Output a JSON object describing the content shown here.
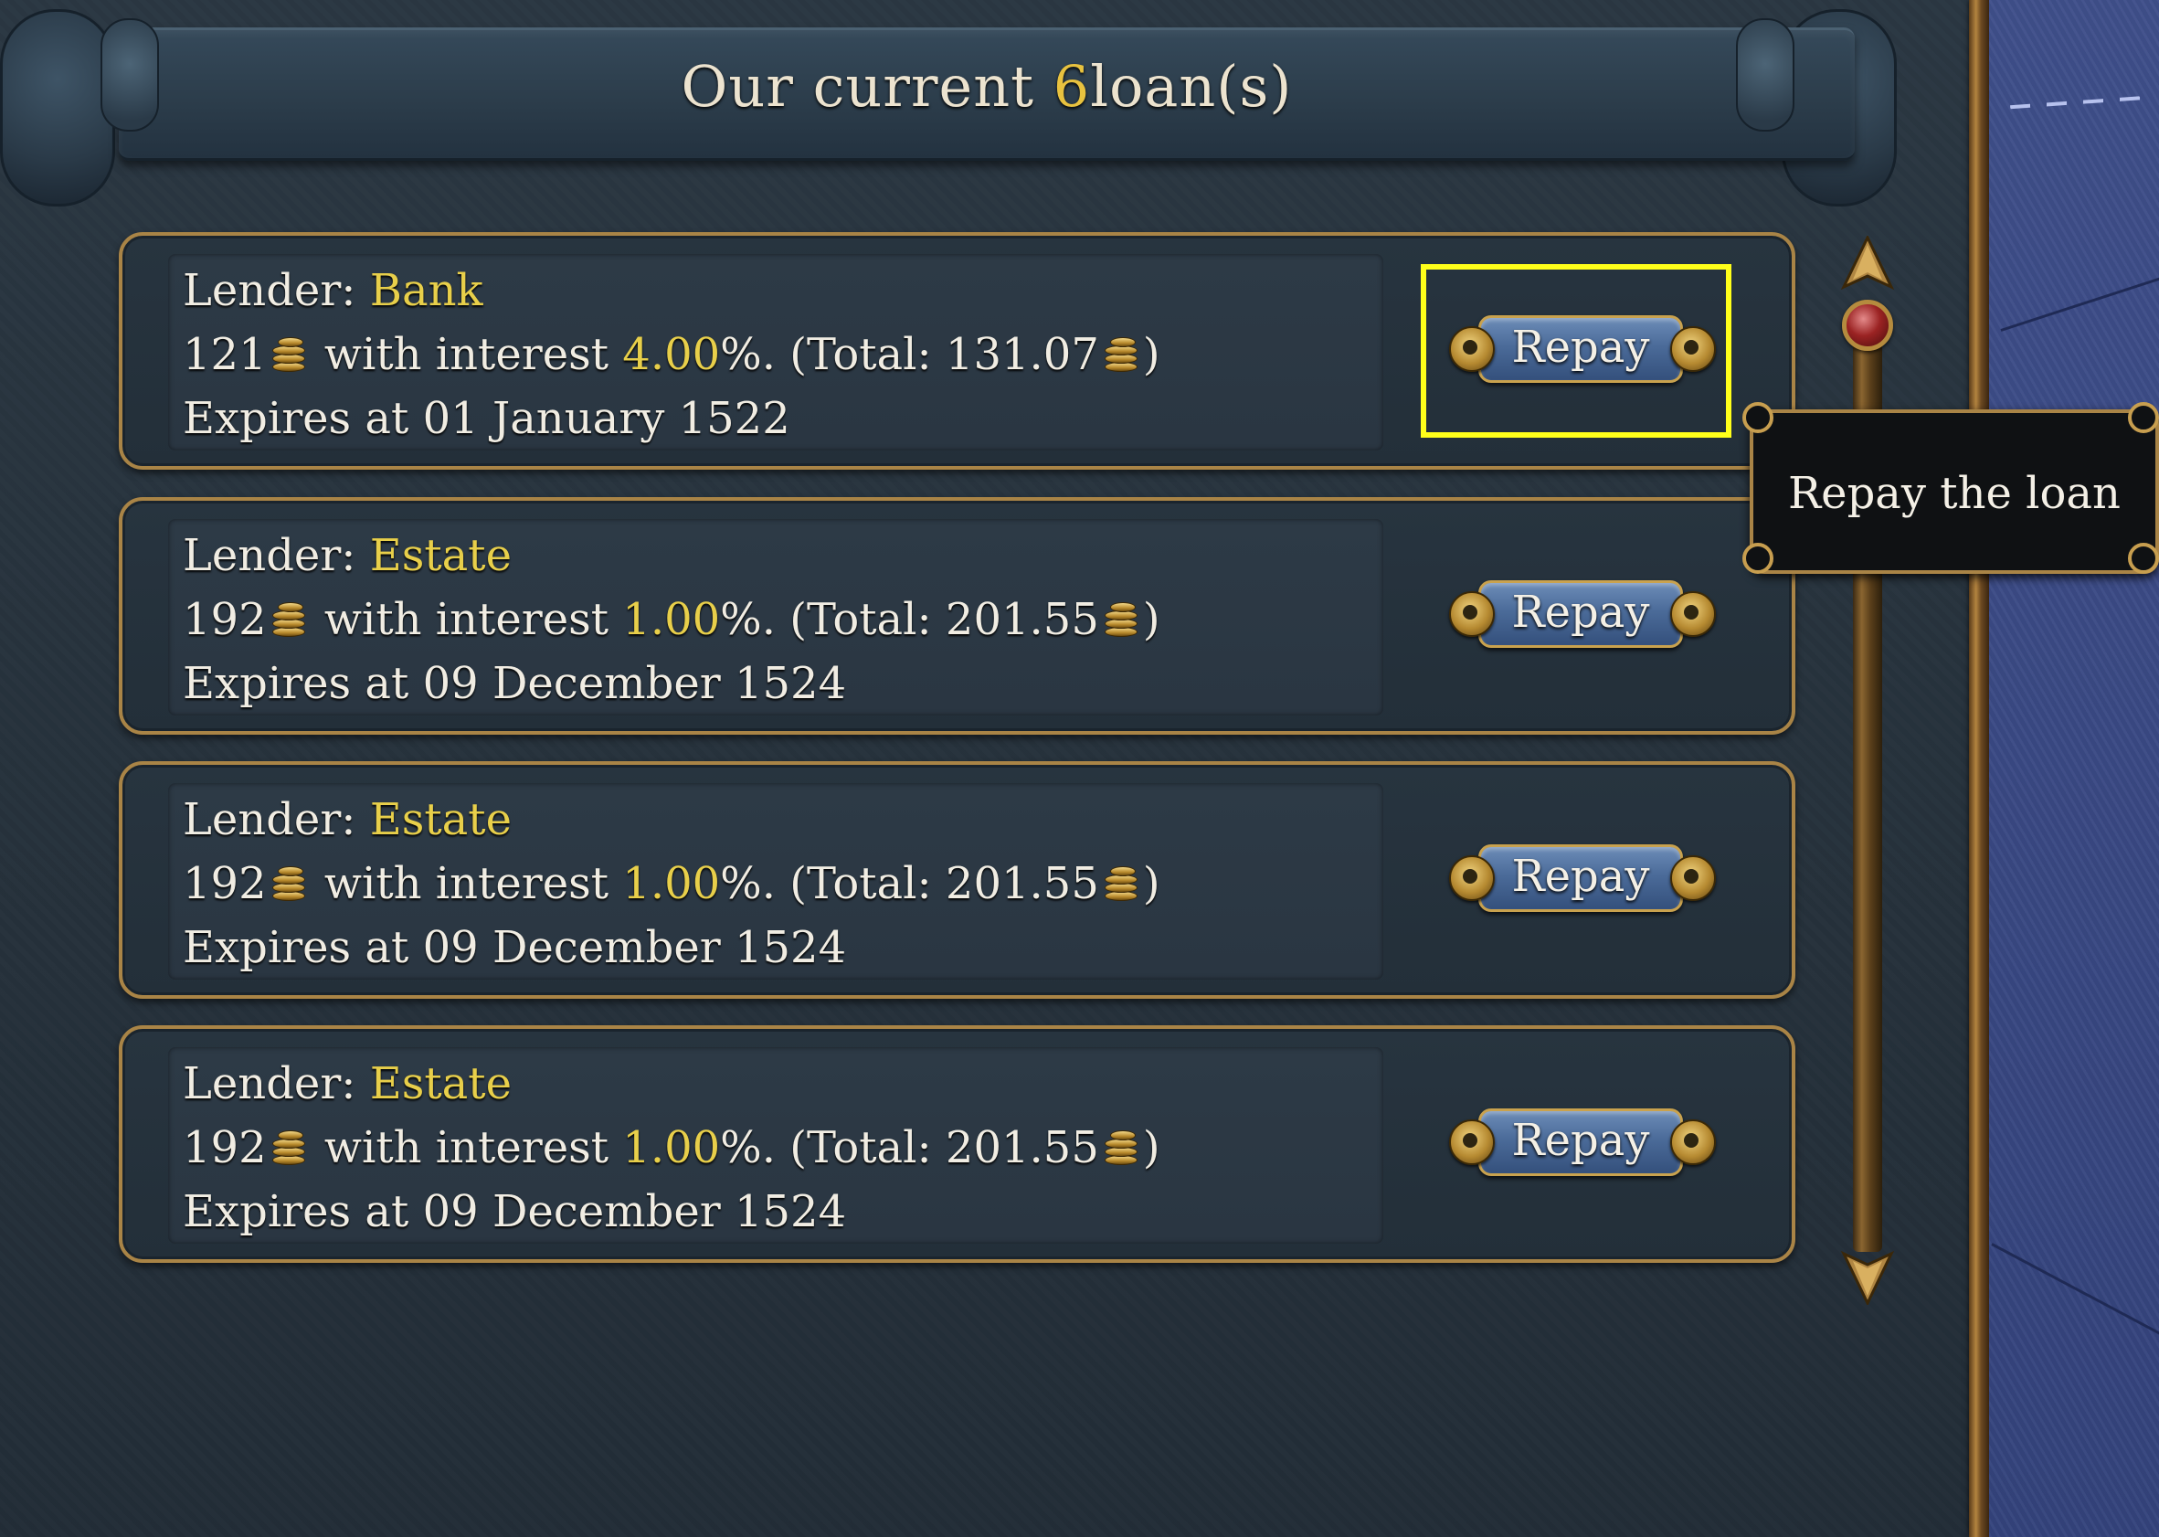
{
  "header": {
    "title_prefix": "Our current",
    "loan_count": "6",
    "title_suffix": "loan(s)"
  },
  "labels": {
    "lender": "Lender:",
    "with_interest": "with interest",
    "percent_suffix": "%. (Total:",
    "close_paren": ")",
    "expires_at": "Expires at"
  },
  "loans": [
    {
      "lender": "Bank",
      "amount": "121",
      "interest": "4.00",
      "total": "131.07",
      "expires": "01 January 1522",
      "repay_label": "Repay"
    },
    {
      "lender": "Estate",
      "amount": "192",
      "interest": "1.00",
      "total": "201.55",
      "expires": "09 December 1524",
      "repay_label": "Repay"
    },
    {
      "lender": "Estate",
      "amount": "192",
      "interest": "1.00",
      "total": "201.55",
      "expires": "09 December 1524",
      "repay_label": "Repay"
    },
    {
      "lender": "Estate",
      "amount": "192",
      "interest": "1.00",
      "total": "201.55",
      "expires": "09 December 1524",
      "repay_label": "Repay"
    }
  ],
  "tooltip": {
    "text": "Repay the loan"
  },
  "colors": {
    "highlight": "#e8cf4a",
    "selection_box": "#ffff1a",
    "frame_gold": "#a98446",
    "button_blue": "#4b6b99"
  },
  "icons": {
    "coin": "gold-coin-stack-icon",
    "knob": "ornament-knob-icon"
  }
}
